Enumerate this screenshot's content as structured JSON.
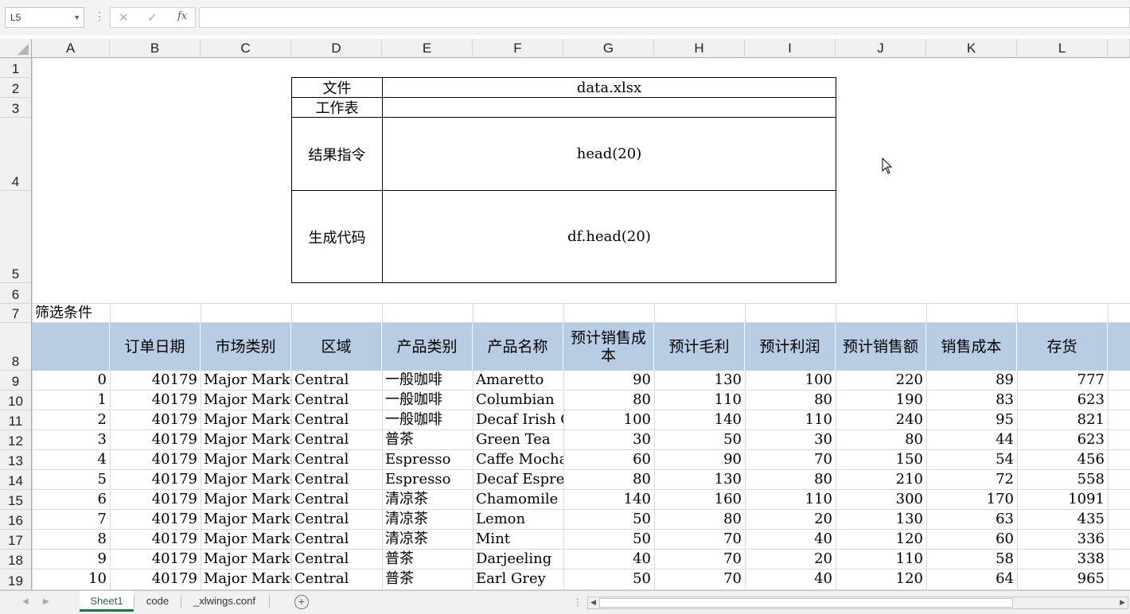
{
  "formula_bar": {
    "name_box": "L5",
    "formula": ""
  },
  "columns": [
    "A",
    "B",
    "C",
    "D",
    "E",
    "F",
    "G",
    "H",
    "I",
    "J",
    "K",
    "L"
  ],
  "rows": [
    "1",
    "2",
    "3",
    "4",
    "5",
    "6",
    "7",
    "8",
    "9",
    "10",
    "11",
    "12",
    "13",
    "14",
    "15",
    "16",
    "17",
    "18",
    "19"
  ],
  "info": {
    "file_label": "文件",
    "file_value": "data.xlsx",
    "sheet_label": "工作表",
    "sheet_value": "",
    "cmd_label": "结果指令",
    "cmd_value": "head(20)",
    "code_label": "生成代码",
    "code_value": "df.head(20)"
  },
  "filter_label": "筛选条件",
  "table": {
    "headers": [
      "",
      "订单日期",
      "市场类别",
      "区域",
      "产品类别",
      "产品名称",
      "预计销售成本",
      "预计毛利",
      "预计利润",
      "预计销售额",
      "销售成本",
      "存货"
    ],
    "rows": [
      [
        "0",
        "40179",
        "Major Market",
        "Central",
        "一般咖啡",
        "Amaretto",
        "90",
        "130",
        "100",
        "220",
        "89",
        "777"
      ],
      [
        "1",
        "40179",
        "Major Market",
        "Central",
        "一般咖啡",
        "Columbian",
        "80",
        "110",
        "80",
        "190",
        "83",
        "623"
      ],
      [
        "2",
        "40179",
        "Major Market",
        "Central",
        "一般咖啡",
        "Decaf Irish Cream",
        "100",
        "140",
        "110",
        "240",
        "95",
        "821"
      ],
      [
        "3",
        "40179",
        "Major Market",
        "Central",
        "普茶",
        "Green Tea",
        "30",
        "50",
        "30",
        "80",
        "44",
        "623"
      ],
      [
        "4",
        "40179",
        "Major Market",
        "Central",
        "Espresso",
        "Caffe Mocha",
        "60",
        "90",
        "70",
        "150",
        "54",
        "456"
      ],
      [
        "5",
        "40179",
        "Major Market",
        "Central",
        "Espresso",
        "Decaf Espresso",
        "80",
        "130",
        "80",
        "210",
        "72",
        "558"
      ],
      [
        "6",
        "40179",
        "Major Market",
        "Central",
        "清凉茶",
        "Chamomile",
        "140",
        "160",
        "110",
        "300",
        "170",
        "1091"
      ],
      [
        "7",
        "40179",
        "Major Market",
        "Central",
        "清凉茶",
        "Lemon",
        "50",
        "80",
        "20",
        "130",
        "63",
        "435"
      ],
      [
        "8",
        "40179",
        "Major Market",
        "Central",
        "清凉茶",
        "Mint",
        "50",
        "70",
        "40",
        "120",
        "60",
        "336"
      ],
      [
        "9",
        "40179",
        "Major Market",
        "Central",
        "普茶",
        "Darjeeling",
        "40",
        "70",
        "20",
        "110",
        "58",
        "338"
      ],
      [
        "10",
        "40179",
        "Major Market",
        "Central",
        "普茶",
        "Earl Grey",
        "50",
        "70",
        "40",
        "120",
        "64",
        "965"
      ]
    ]
  },
  "sheet_tabs": [
    "Sheet1",
    "code",
    "_xlwings.conf"
  ],
  "active_tab": "Sheet1",
  "colors": {
    "header_fill": "#b8cce4",
    "active_tab": "#217346"
  }
}
